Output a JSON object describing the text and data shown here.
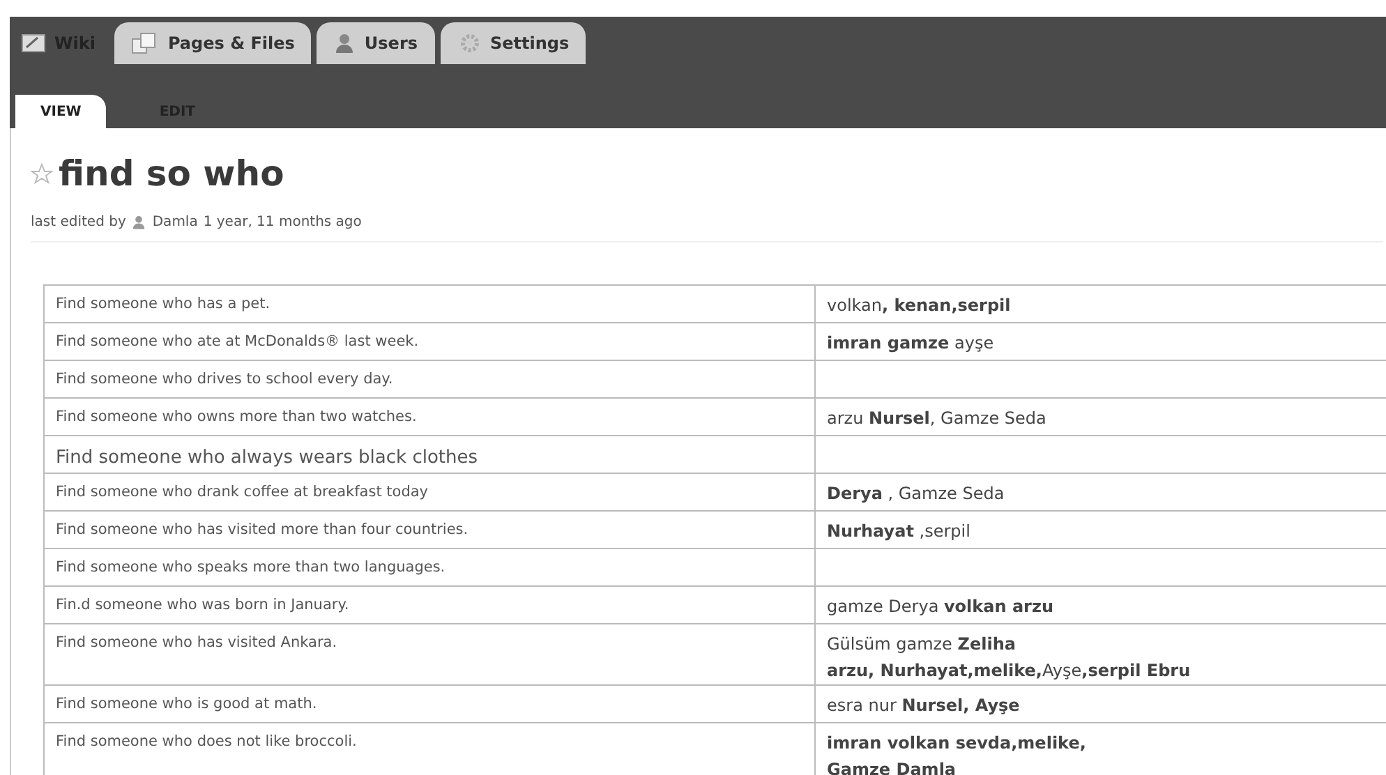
{
  "app": {
    "name": "Wiki"
  },
  "tabs": [
    {
      "label": "Pages & Files",
      "kind": "pages"
    },
    {
      "label": "Users",
      "kind": "user"
    },
    {
      "label": "Settings",
      "kind": "gear"
    }
  ],
  "subtabs": [
    {
      "label": "VIEW",
      "selected": true
    },
    {
      "label": "EDIT",
      "selected": false
    }
  ],
  "page": {
    "title": "find so who",
    "starred": false,
    "meta_prefix": "last edited by",
    "author": "Damla",
    "time": "1 year, 11 months ago"
  },
  "table": {
    "rows": [
      {
        "kind": "normal",
        "question": "Find someone who has a pet.",
        "answer": [
          "volkan**, kenan,serpil**"
        ]
      },
      {
        "kind": "normal",
        "question": "Find someone who ate at McDonalds® last week.",
        "answer": [
          "**imran gamze** ayşe"
        ]
      },
      {
        "kind": "normal",
        "question": "Find someone who drives to school every day.",
        "answer": []
      },
      {
        "kind": "normal",
        "question": "Find someone who owns more than two watches.",
        "answer": [
          "arzu **Nursel**, Gamze Seda"
        ]
      },
      {
        "kind": "large",
        "question": "Find someone who always wears black clothes",
        "answer": []
      },
      {
        "kind": "normal",
        "question": "Find someone who drank coffee at breakfast today",
        "answer": [
          " **Derya** , Gamze Seda"
        ]
      },
      {
        "kind": "normal",
        "question": "Find someone who has visited more than four countries.",
        "answer": [
          "**Nurhayat** ,serpil"
        ]
      },
      {
        "kind": "normal",
        "question": "Find someone who speaks more than two languages.",
        "answer": []
      },
      {
        "kind": "normal",
        "question": "Fin.d someone who was born in January.",
        "answer": [
          " gamze Derya **volkan arzu**"
        ]
      },
      {
        "kind": "normal",
        "question": "Find someone who has visited Ankara.",
        "answer": [
          "Gülsüm gamze **Zeliha**",
          "**arzu, Nurhayat,melike,**Ayşe**,serpil Ebru**"
        ]
      },
      {
        "kind": "normal",
        "question": "Find someone who is good at math.",
        "answer": [
          "esra nur **Nursel, Ayşe**"
        ]
      },
      {
        "kind": "normal",
        "question": "Find someone who does not like broccoli.",
        "answer": [
          " **imran volkan sevda,melike,**",
          "**Gamze Damla**"
        ]
      }
    ]
  }
}
